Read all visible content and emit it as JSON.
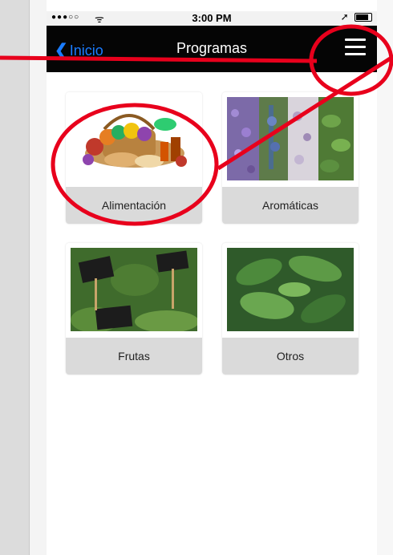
{
  "status_bar": {
    "signal": "●●●○○",
    "wifi": "ᯤ",
    "time": "3:00 PM",
    "location_arrow": "➚"
  },
  "navbar": {
    "back_label": "Inicio",
    "title": "Programas",
    "menu_icon": "hamburger-menu-icon"
  },
  "programs": [
    {
      "label": "Alimentación",
      "image": "food-basket-image"
    },
    {
      "label": "Aromáticas",
      "image": "herbs-collage-image"
    },
    {
      "label": "Frutas",
      "image": "herb-signs-image"
    },
    {
      "label": "Otros",
      "image": "leaves-image"
    }
  ],
  "colors": {
    "navbar": "#050505",
    "back_link": "#1a7cff",
    "card_label_bg": "#dadada",
    "annotation": "#e8001c"
  }
}
